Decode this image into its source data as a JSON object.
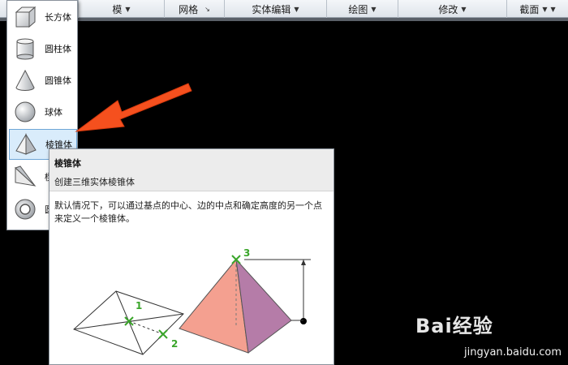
{
  "ribbon": {
    "panels": [
      {
        "label": "模",
        "has_arrow": true
      },
      {
        "label": "网格",
        "has_launcher": true
      },
      {
        "label": "实体编辑",
        "has_arrow": true
      },
      {
        "label": "绘图",
        "has_arrow": true
      },
      {
        "label": "修改",
        "has_arrow": true
      },
      {
        "label": "截面",
        "has_arrow": true
      }
    ]
  },
  "gallery": {
    "items": [
      {
        "label": "长方体",
        "icon": "box-icon"
      },
      {
        "label": "圆柱体",
        "icon": "cylinder-icon"
      },
      {
        "label": "圆锥体",
        "icon": "cone-icon"
      },
      {
        "label": "球体",
        "icon": "sphere-icon"
      },
      {
        "label": "棱锥体",
        "icon": "pyramid-icon",
        "active": true
      },
      {
        "label": "楔",
        "icon": "wedge-icon"
      },
      {
        "label": "圆",
        "icon": "torus-icon"
      }
    ]
  },
  "tooltip": {
    "title": "棱锥体",
    "subtitle": "创建三维实体棱锥体",
    "description": "默认情况下，可以通过基点的中心、边的中点和确定高度的另一个点来定义一个棱锥体。",
    "figure_labels": [
      "1",
      "2",
      "3"
    ]
  },
  "colors": {
    "pointer_arrow": "#f5501e",
    "pyramid_front": "#f4a090",
    "pyramid_side": "#b57ca8",
    "marker_green": "#3aa52a"
  },
  "watermark": {
    "text": "Bai经验",
    "url": "jingyan.baidu.com"
  }
}
